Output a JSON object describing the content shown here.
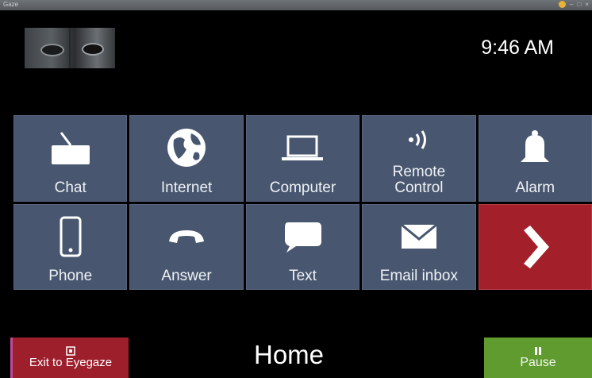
{
  "window": {
    "title": "Gaze",
    "controls": [
      "–",
      "□",
      "×"
    ]
  },
  "clock": "9:46 AM",
  "tiles": [
    {
      "label": "Chat",
      "icon": "chat-keyboard-icon"
    },
    {
      "label": "Internet",
      "icon": "globe-icon"
    },
    {
      "label": "Computer",
      "icon": "laptop-icon"
    },
    {
      "label": "Remote\nControl",
      "icon": "remote-signal-icon"
    },
    {
      "label": "Alarm",
      "icon": "bell-icon"
    },
    {
      "label": "Phone",
      "icon": "phone-icon"
    },
    {
      "label": "Answer",
      "icon": "handset-icon"
    },
    {
      "label": "Text",
      "icon": "speech-bubble-icon"
    },
    {
      "label": "Email inbox",
      "icon": "envelope-icon"
    },
    {
      "label": "",
      "icon": "chevron-right-icon"
    }
  ],
  "bottom": {
    "exit_label": "Exit to Eyegaze",
    "title": "Home",
    "pause_label": "Pause"
  },
  "colors": {
    "tile": "#48576f",
    "next_tile": "#a3202b",
    "exit": "#9e1f2c",
    "pause": "#5f9b2e"
  }
}
